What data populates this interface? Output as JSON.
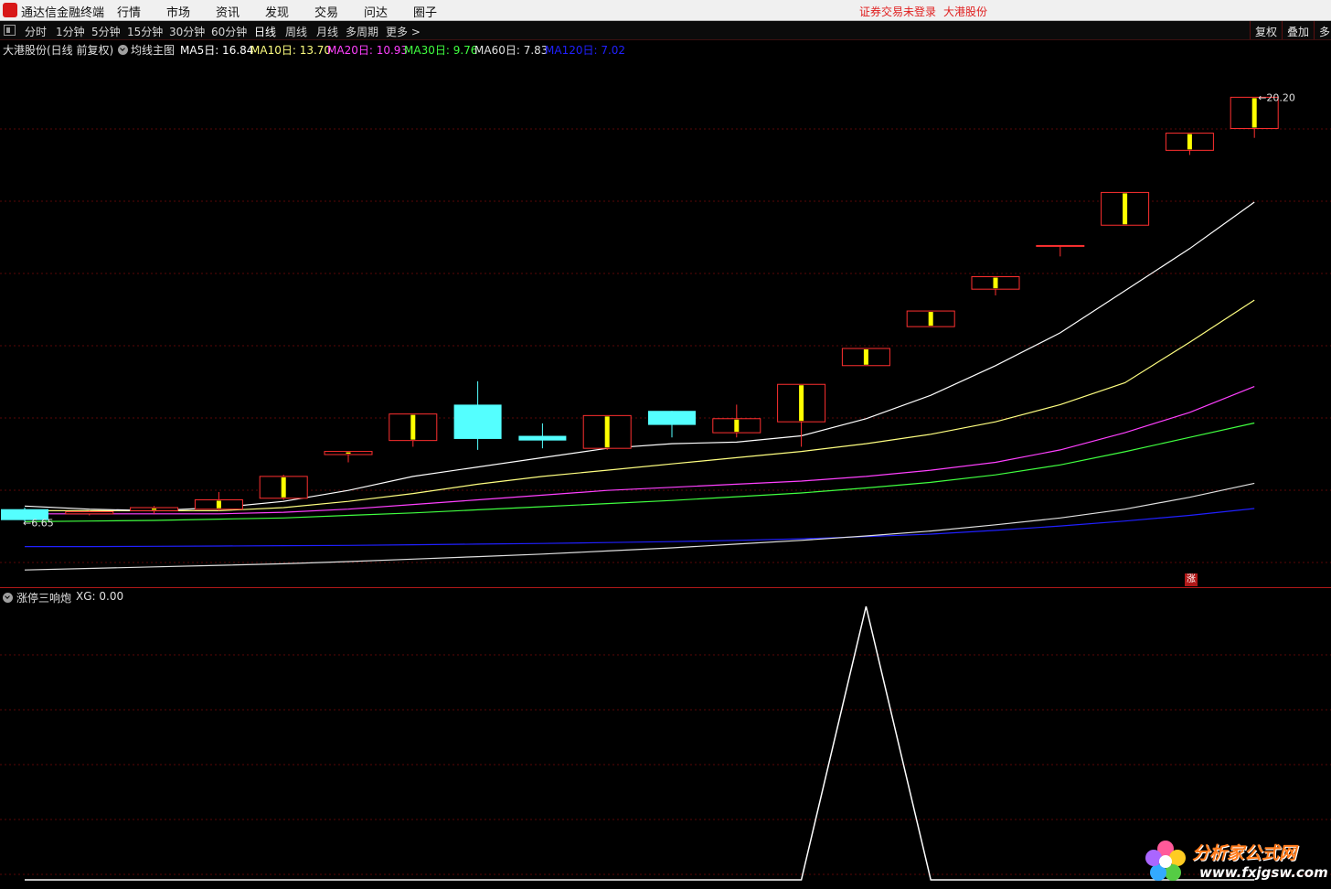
{
  "app": {
    "title": "通达信金融终端",
    "menu": [
      "行情",
      "市场",
      "资讯",
      "发现",
      "交易",
      "问达",
      "圈子"
    ],
    "login_status": "证券交易未登录",
    "stock_name": "大港股份"
  },
  "toolbar": {
    "periods": [
      "分时",
      "1分钟",
      "5分钟",
      "15分钟",
      "30分钟",
      "60分钟",
      "日线",
      "周线",
      "月线",
      "多周期",
      "更多 >"
    ],
    "active_period": "日线",
    "right_buttons": [
      "复权",
      "叠加",
      "多"
    ]
  },
  "info": {
    "stock_label": "大港股份(日线 前复权)",
    "template": "均线主图",
    "ma": [
      {
        "label": "MA5日: 16.84",
        "color": "#ffffff"
      },
      {
        "label": "MA10日: 13.70",
        "color": "#ffff80"
      },
      {
        "label": "MA20日: 10.93",
        "color": "#ff40ff"
      },
      {
        "label": "MA30日: 9.76",
        "color": "#40ff40"
      },
      {
        "label": "MA60日: 7.83",
        "color": "#e0e0e0"
      },
      {
        "label": "MA120日: 7.02",
        "color": "#2020ff"
      }
    ]
  },
  "colors": {
    "up": "#ff3030",
    "down": "#54ffff",
    "body_marker": "#ffff00",
    "grid": "#5a0808",
    "ma5": "#ffffff",
    "ma10": "#ffff80",
    "ma20": "#ff40ff",
    "ma30": "#40ff40",
    "ma60": "#e0e0e0",
    "ma120": "#2020ff"
  },
  "chart_data": [
    {
      "type": "candlestick",
      "ylim": [
        4.5,
        21.5
      ],
      "candles": [
        {
          "o": 7.0,
          "h": 7.05,
          "l": 6.6,
          "c": 6.65,
          "dir": "down"
        },
        {
          "o": 6.85,
          "h": 6.95,
          "l": 6.8,
          "c": 6.92,
          "dir": "up"
        },
        {
          "o": 6.95,
          "h": 7.1,
          "l": 6.85,
          "c": 7.05,
          "dir": "up"
        },
        {
          "o": 7.0,
          "h": 7.55,
          "l": 6.95,
          "c": 7.3,
          "dir": "up"
        },
        {
          "o": 7.35,
          "h": 8.1,
          "l": 7.3,
          "c": 8.05,
          "dir": "up"
        },
        {
          "o": 8.75,
          "h": 8.85,
          "l": 8.5,
          "c": 8.85,
          "dir": "up"
        },
        {
          "o": 9.2,
          "h": 10.05,
          "l": 9.0,
          "c": 10.05,
          "dir": "up"
        },
        {
          "o": 10.35,
          "h": 11.1,
          "l": 8.9,
          "c": 9.25,
          "dir": "down"
        },
        {
          "o": 9.35,
          "h": 9.75,
          "l": 8.95,
          "c": 9.2,
          "dir": "down"
        },
        {
          "o": 8.95,
          "h": 10.0,
          "l": 8.9,
          "c": 10.0,
          "dir": "up"
        },
        {
          "o": 10.15,
          "h": 10.15,
          "l": 9.3,
          "c": 9.7,
          "dir": "down"
        },
        {
          "o": 9.45,
          "h": 10.35,
          "l": 9.3,
          "c": 9.9,
          "dir": "up"
        },
        {
          "o": 9.8,
          "h": 11.0,
          "l": 9.0,
          "c": 11.0,
          "dir": "up"
        },
        {
          "o": 11.6,
          "h": 12.15,
          "l": 11.6,
          "c": 12.15,
          "dir": "up"
        },
        {
          "o": 12.85,
          "h": 13.35,
          "l": 12.85,
          "c": 13.35,
          "dir": "up"
        },
        {
          "o": 14.05,
          "h": 14.45,
          "l": 13.85,
          "c": 14.45,
          "dir": "up"
        },
        {
          "o": 15.45,
          "h": 15.45,
          "l": 15.1,
          "c": 15.45,
          "dir": "up"
        },
        {
          "o": 16.1,
          "h": 17.15,
          "l": 16.1,
          "c": 17.15,
          "dir": "up"
        },
        {
          "o": 18.5,
          "h": 19.05,
          "l": 18.35,
          "c": 19.05,
          "dir": "up"
        },
        {
          "o": 19.2,
          "h": 20.2,
          "l": 18.9,
          "c": 20.2,
          "dir": "up"
        }
      ],
      "ma_lines": {
        "ma5": [
          7.1,
          7.0,
          6.95,
          7.05,
          7.25,
          7.6,
          8.05,
          8.35,
          8.65,
          8.95,
          9.1,
          9.15,
          9.35,
          9.9,
          10.65,
          11.6,
          12.65,
          14.0,
          15.35,
          16.84
        ],
        "ma10": [
          6.95,
          6.95,
          6.95,
          6.95,
          7.05,
          7.25,
          7.5,
          7.8,
          8.05,
          8.25,
          8.45,
          8.65,
          8.85,
          9.1,
          9.4,
          9.8,
          10.35,
          11.05,
          12.35,
          13.7
        ],
        "ma20": [
          6.85,
          6.85,
          6.85,
          6.85,
          6.9,
          7.0,
          7.15,
          7.3,
          7.45,
          7.6,
          7.7,
          7.8,
          7.9,
          8.05,
          8.25,
          8.5,
          8.9,
          9.45,
          10.1,
          10.93
        ],
        "ma30": [
          6.6,
          6.62,
          6.64,
          6.68,
          6.72,
          6.8,
          6.88,
          6.98,
          7.08,
          7.18,
          7.28,
          7.4,
          7.52,
          7.68,
          7.86,
          8.1,
          8.42,
          8.84,
          9.3,
          9.76
        ],
        "ma60": [
          5.05,
          5.1,
          5.15,
          5.2,
          5.25,
          5.32,
          5.4,
          5.48,
          5.56,
          5.66,
          5.76,
          5.88,
          6.0,
          6.14,
          6.3,
          6.5,
          6.72,
          7.0,
          7.38,
          7.83
        ],
        "ma120": [
          5.8,
          5.8,
          5.81,
          5.82,
          5.83,
          5.84,
          5.86,
          5.88,
          5.9,
          5.93,
          5.96,
          6.0,
          6.05,
          6.12,
          6.2,
          6.32,
          6.46,
          6.62,
          6.8,
          7.02
        ]
      },
      "low_label": "6.65",
      "high_label": "20.20",
      "low_prefix": "←",
      "high_prefix": "←",
      "zt_badge": "涨"
    },
    {
      "type": "line",
      "title": "涨停三响炮",
      "value_label": "XG: 0.00",
      "ylim": [
        0,
        1
      ],
      "values": [
        0,
        0,
        0,
        0,
        0,
        0,
        0,
        0,
        0,
        0,
        0,
        0,
        0,
        1,
        0,
        0,
        0,
        0,
        0,
        0
      ]
    }
  ],
  "watermark": {
    "text1": "分析家公式网",
    "text2": "www.fxjgsw.com"
  }
}
